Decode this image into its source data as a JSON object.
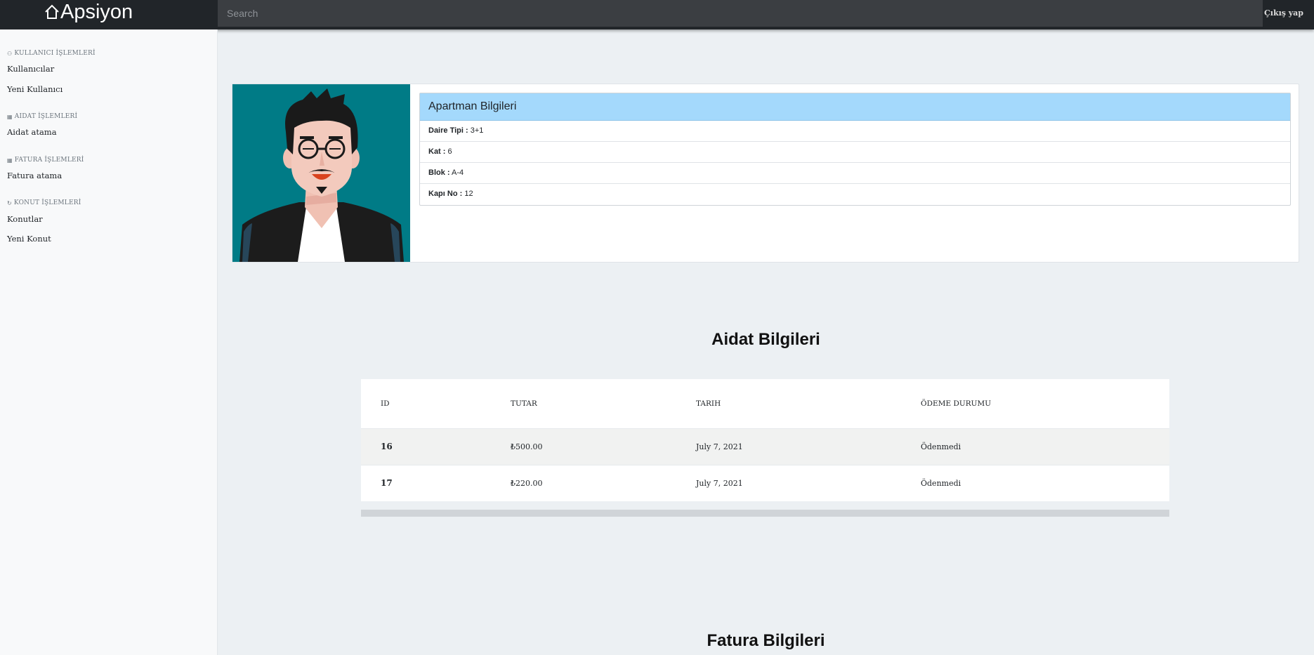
{
  "app": {
    "brand": "Apsiyon",
    "search_placeholder": "Search",
    "logout_label": "Çıkış yap"
  },
  "sidebar": {
    "sections": [
      {
        "title": "KULLANICI İŞLEMLERİ",
        "icon": "users-icon",
        "links": [
          "Kullanıcılar",
          "Yeni Kullanıcı"
        ]
      },
      {
        "title": "AIDAT İŞLEMLERİ",
        "icon": "calculator-icon",
        "links": [
          "Aidat atama"
        ]
      },
      {
        "title": "FATURA İŞLEMLERİ",
        "icon": "calculator-icon",
        "links": [
          "Fatura atama"
        ]
      },
      {
        "title": "KONUT İŞLEMLERİ",
        "icon": "refresh-icon",
        "links": [
          "Konutlar",
          "Yeni Konut"
        ]
      }
    ]
  },
  "apartment": {
    "title": "Apartman Bilgileri",
    "rows": [
      {
        "label": "Daire Tipi :",
        "value": "3+1"
      },
      {
        "label": "Kat :",
        "value": "6"
      },
      {
        "label": "Blok :",
        "value": "A-4"
      },
      {
        "label": "Kapı No :",
        "value": "12"
      }
    ]
  },
  "aidat": {
    "title": "Aidat Bilgileri",
    "columns": [
      "ID",
      "TUTAR",
      "TARIH",
      "ÖDEME DURUMU"
    ],
    "rows": [
      {
        "id": "16",
        "amount": "₺500.00",
        "date": "July 7, 2021",
        "status": "Ödenmedi"
      },
      {
        "id": "17",
        "amount": "₺220.00",
        "date": "July 7, 2021",
        "status": "Ödenmedi"
      }
    ]
  },
  "fatura": {
    "title": "Fatura Bilgileri"
  },
  "colors": {
    "topbar": "#212529",
    "info_header": "#a4d9fc",
    "avatar_bg": "#007b86",
    "page_bg": "#ecf0f3"
  }
}
